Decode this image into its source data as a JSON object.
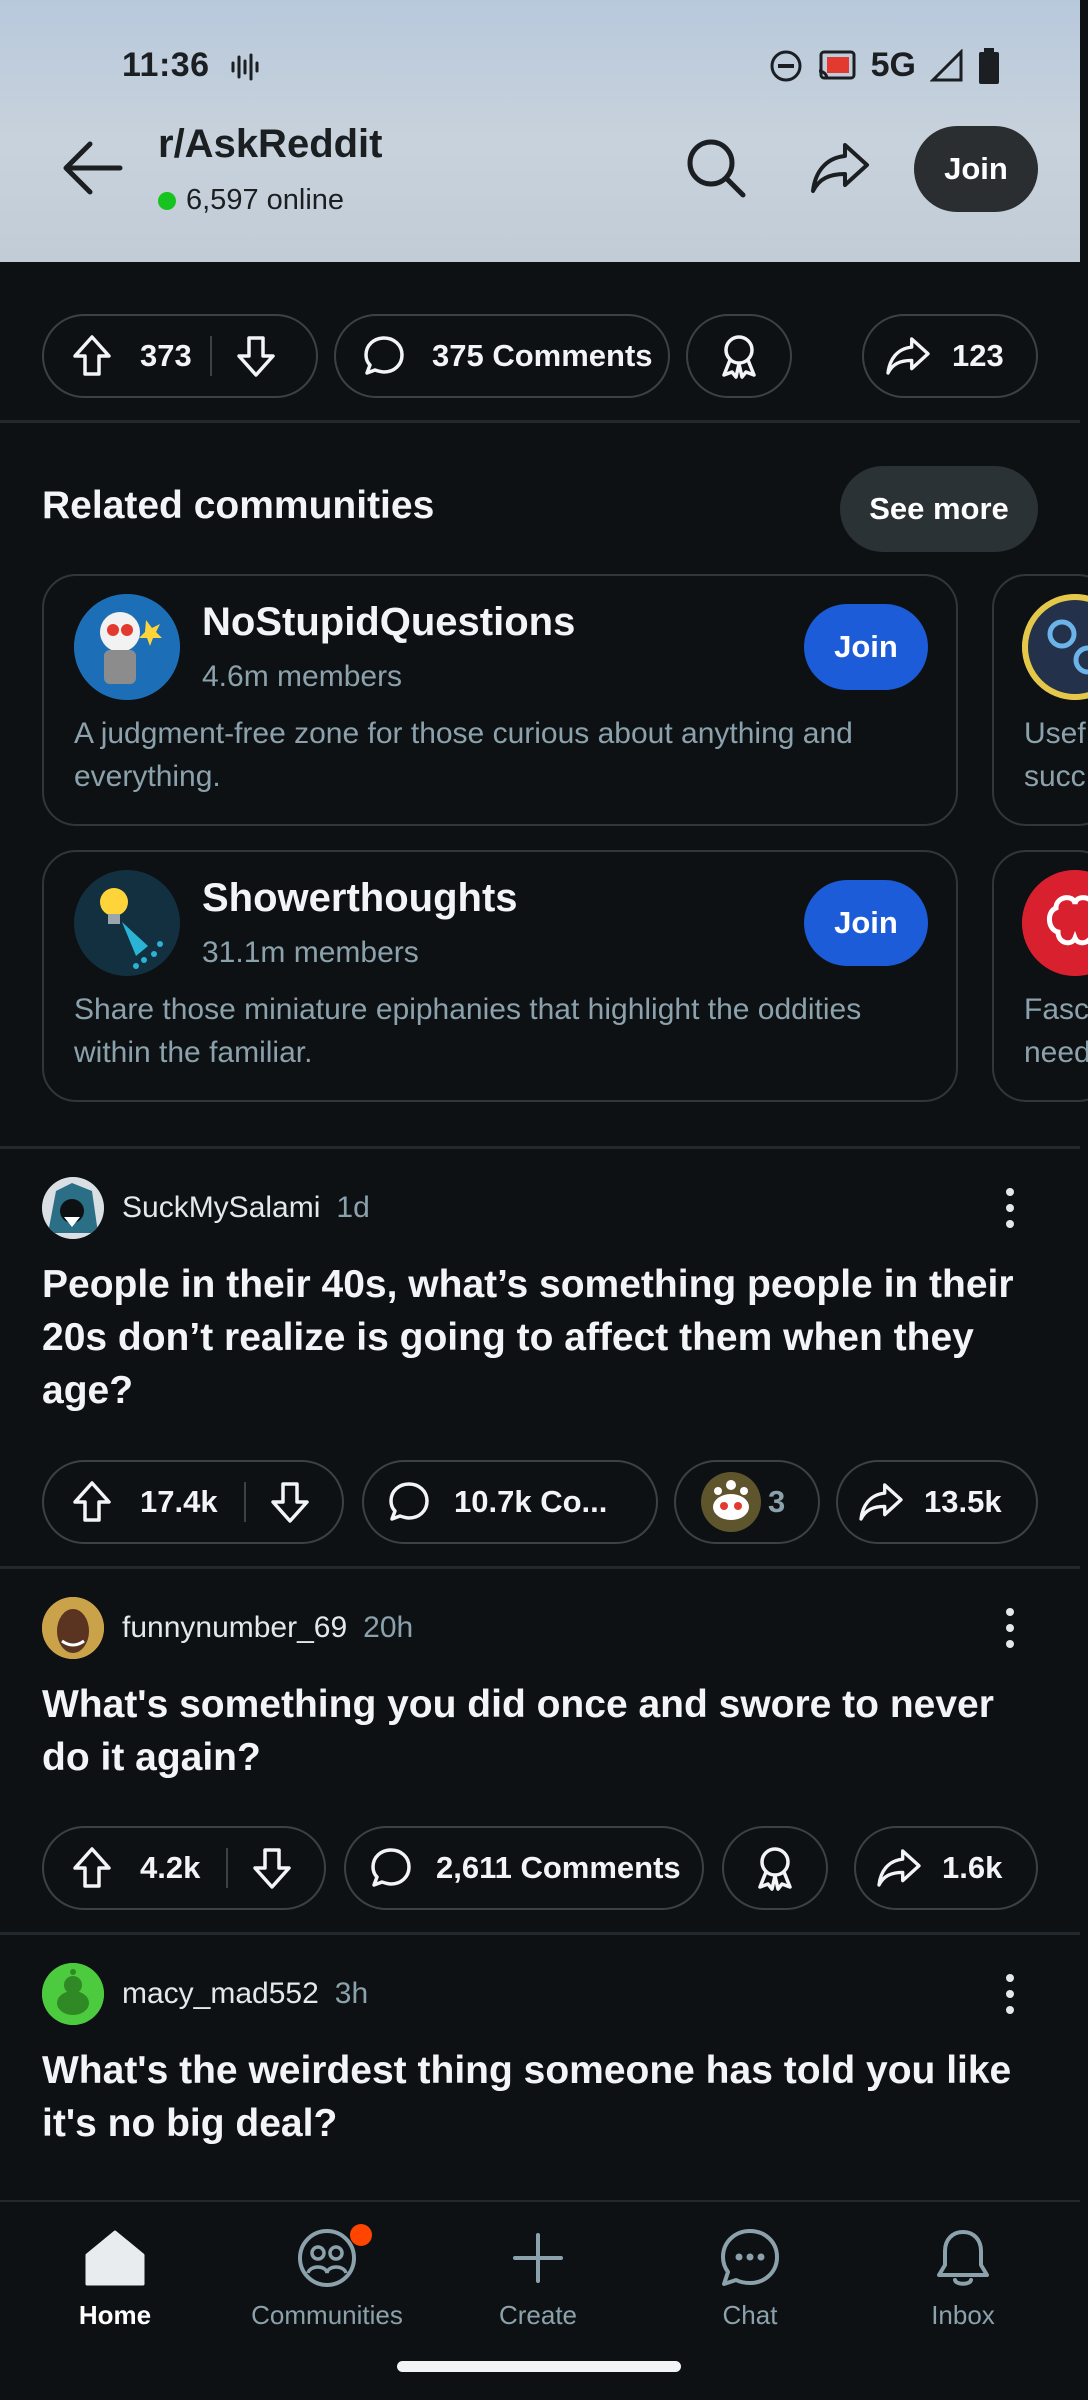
{
  "status_bar": {
    "time": "11:36",
    "network": "5G"
  },
  "header": {
    "subreddit": "r/AskReddit",
    "online": "6,597 online",
    "join_label": "Join"
  },
  "top_actions": {
    "upvotes": "373",
    "comments": "375 Comments",
    "shares": "123"
  },
  "related": {
    "title": "Related communities",
    "see_more": "See more",
    "cards": [
      {
        "name": "NoStupidQuestions",
        "members": "4.6m members",
        "description": "A judgment-free zone for those curious about anything and everything.",
        "join_label": "Join",
        "peek_text": "Usef\nsucc"
      },
      {
        "name": "Showerthoughts",
        "members": "31.1m members",
        "description": "Share those miniature epiphanies that highlight the oddities within the familiar.",
        "join_label": "Join",
        "peek_text": "Fasc\nneed"
      }
    ]
  },
  "posts": [
    {
      "author": "SuckMySalami",
      "age": "1d",
      "title": "People in their 40s, what’s something people in their 20s don’t realize is going to affect them when they age?",
      "upvotes": "17.4k",
      "comments": "10.7k Co...",
      "awards": "3",
      "shares": "13.5k"
    },
    {
      "author": "funnynumber_69",
      "age": "20h",
      "title": "What's something you did once and swore to never do it again?",
      "upvotes": "4.2k",
      "comments": "2,611 Comments",
      "shares": "1.6k"
    },
    {
      "author": "macy_mad552",
      "age": "3h",
      "title": "What's the weirdest thing someone has told you like it's no big deal?"
    }
  ],
  "bottom_nav": {
    "home": "Home",
    "communities": "Communities",
    "create": "Create",
    "chat": "Chat",
    "inbox": "Inbox"
  },
  "colors": {
    "background": "#0e1113",
    "join_blue": "#1c5cd8",
    "online_green": "#17c31f",
    "notification": "#ff4500"
  }
}
